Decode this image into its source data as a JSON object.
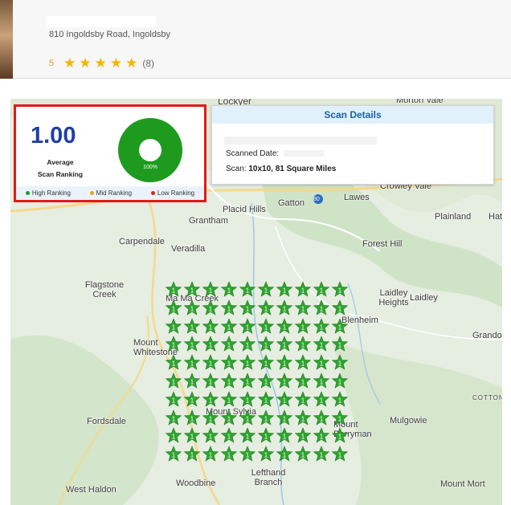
{
  "business": {
    "address": "810 Ingoldsby Road, Ingoldsby",
    "rating_value": "5",
    "stars": 5,
    "review_count": "(8)"
  },
  "summary": {
    "average_value": "1.00",
    "average_label_1": "Average",
    "average_label_2": "Scan Ranking",
    "donut_percent": "100%",
    "high_share": 1.0,
    "legend": [
      "High Ranking",
      "Mid Ranking",
      "Low Ranking"
    ],
    "colors": {
      "high": "#1e9b1e",
      "mid": "#f0a020",
      "low": "#d9261c",
      "accent": "#1e3fa8",
      "frame": "#e21a1a"
    }
  },
  "scan_details": {
    "title": "Scan Details",
    "scanned_date_label": "Scanned Date:",
    "scan_label": "Scan:",
    "scan_value": "10x10, 81 Square Miles"
  },
  "grid": {
    "rows": 10,
    "cols": 10,
    "rank_label": "1",
    "pin_color": "#2ea52e"
  },
  "map": {
    "labels": [
      "Lockyer",
      "Morton Vale",
      "Lawes",
      "Crowley Vale",
      "Gatton",
      "Placid Hills",
      "Grantham",
      "Plainland",
      "Hat",
      "Carpendale",
      "Veradilla",
      "Forest Hill",
      "Flagstone Creek",
      "Ma Ma Creek",
      "Laidley Heights",
      "Laidley",
      "Blenheim",
      "Grando",
      "Mount Whitestone",
      "COTTON",
      "Fordsdale",
      "Mulgowie",
      "Lefthand Branch",
      "Woodbine",
      "West Haldon",
      "Mount Mort",
      "Mount Sylvia",
      "Mount Berryman",
      "80"
    ]
  }
}
